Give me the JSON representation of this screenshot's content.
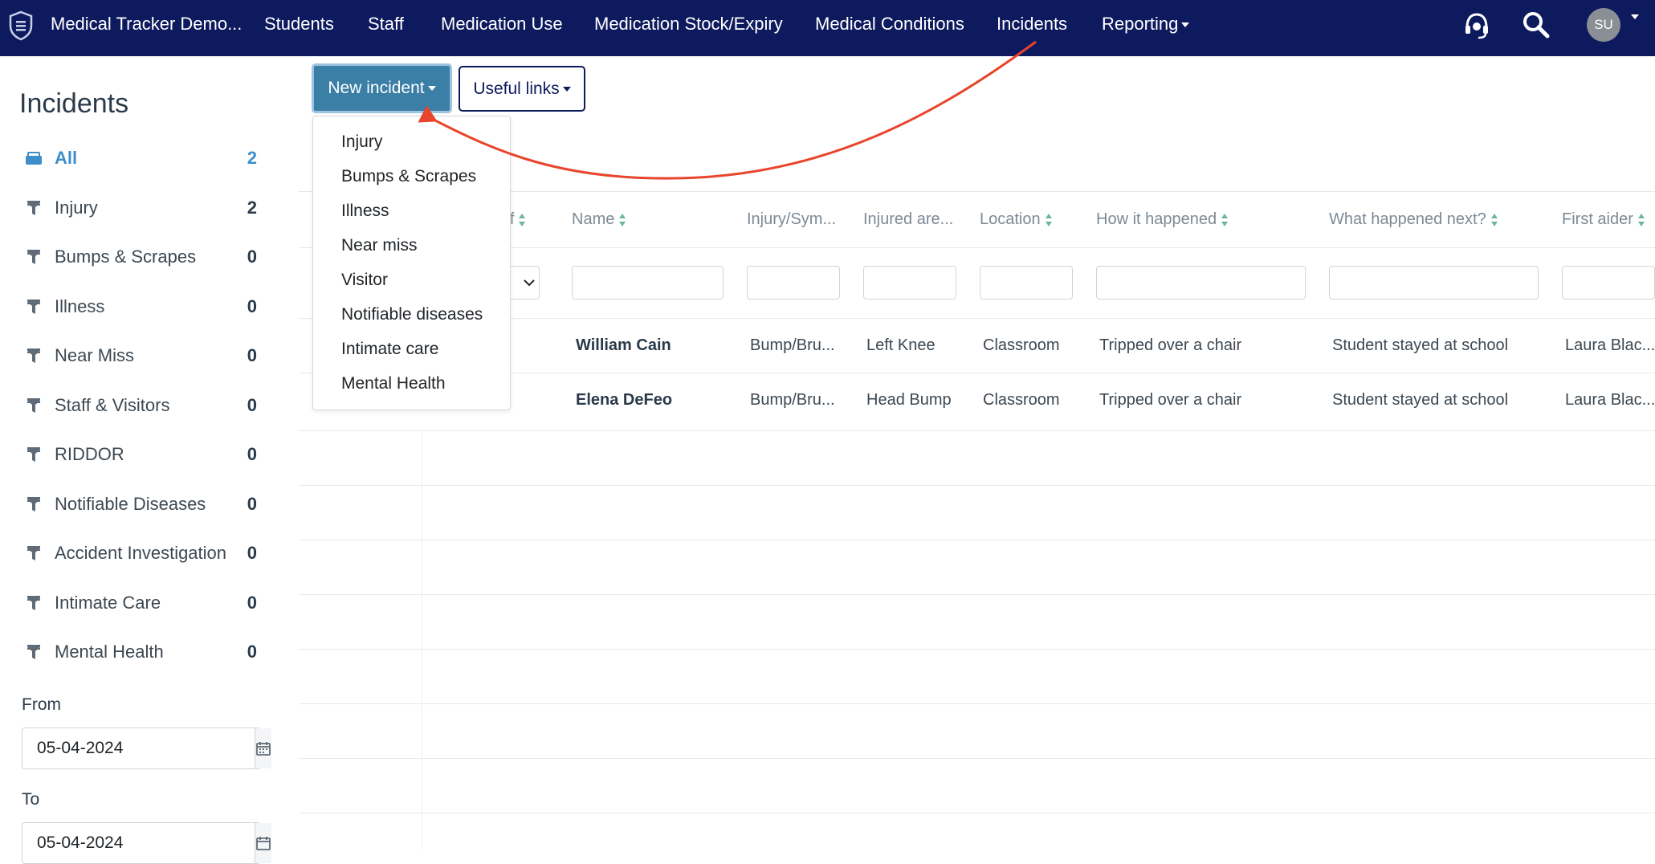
{
  "navbar": {
    "brand": "Medical Tracker Demo...",
    "items": [
      "Students",
      "Staff",
      "Medication Use",
      "Medication Stock/Expiry",
      "Medical Conditions",
      "Incidents"
    ],
    "reporting": "Reporting",
    "avatar_initials": "SU",
    "background": "#0e1a5e"
  },
  "sidebar": {
    "title": "Incidents",
    "items": [
      {
        "label": "All",
        "count": "2",
        "icon": "inbox-icon"
      },
      {
        "label": "Injury",
        "count": "2",
        "icon": "filter-icon"
      },
      {
        "label": "Bumps & Scrapes",
        "count": "0",
        "icon": "filter-icon"
      },
      {
        "label": "Illness",
        "count": "0",
        "icon": "filter-icon"
      },
      {
        "label": "Near Miss",
        "count": "0",
        "icon": "filter-icon"
      },
      {
        "label": "Staff & Visitors",
        "count": "0",
        "icon": "filter-icon"
      },
      {
        "label": "RIDDOR",
        "count": "0",
        "icon": "filter-icon"
      },
      {
        "label": "Notifiable Diseases",
        "count": "0",
        "icon": "filter-icon"
      },
      {
        "label": "Accident Investigation",
        "count": "0",
        "icon": "filter-icon"
      },
      {
        "label": "Intimate Care",
        "count": "0",
        "icon": "filter-icon"
      },
      {
        "label": "Mental Health",
        "count": "0",
        "icon": "filter-icon"
      }
    ],
    "from_label": "From",
    "from_value": "05-04-2024",
    "to_label": "To",
    "to_value": "05-04-2024"
  },
  "toolbar": {
    "new_incident": "New incident",
    "useful_links": "Useful links"
  },
  "dropdown": {
    "items": [
      "Injury",
      "Bumps & Scrapes",
      "Illness",
      "Near miss",
      "Visitor",
      "Notifiable diseases",
      "Intimate care",
      "Mental Health"
    ]
  },
  "table": {
    "headers": [
      "taff",
      "Name",
      "Injury/Sym...",
      "Injured are...",
      "Location",
      "How it happened",
      "What happened next?",
      "First aider"
    ],
    "rows": [
      {
        "name": "William Cain",
        "injury": "Bump/Bru...",
        "area": "Left Knee",
        "location": "Classroom",
        "how": "Tripped over a chair",
        "next": "Student stayed at school",
        "aider": "Laura Blac..."
      },
      {
        "name": "Elena DeFeo",
        "injury": "Bump/Bru...",
        "area": "Head Bump",
        "location": "Classroom",
        "how": "Tripped over a chair",
        "next": "Student stayed at school",
        "aider": "Laura Blac..."
      }
    ]
  },
  "colors": {
    "accent": "#3d8fc9",
    "primary_button": "#3b7ea6",
    "arrow": "#e8452c"
  }
}
